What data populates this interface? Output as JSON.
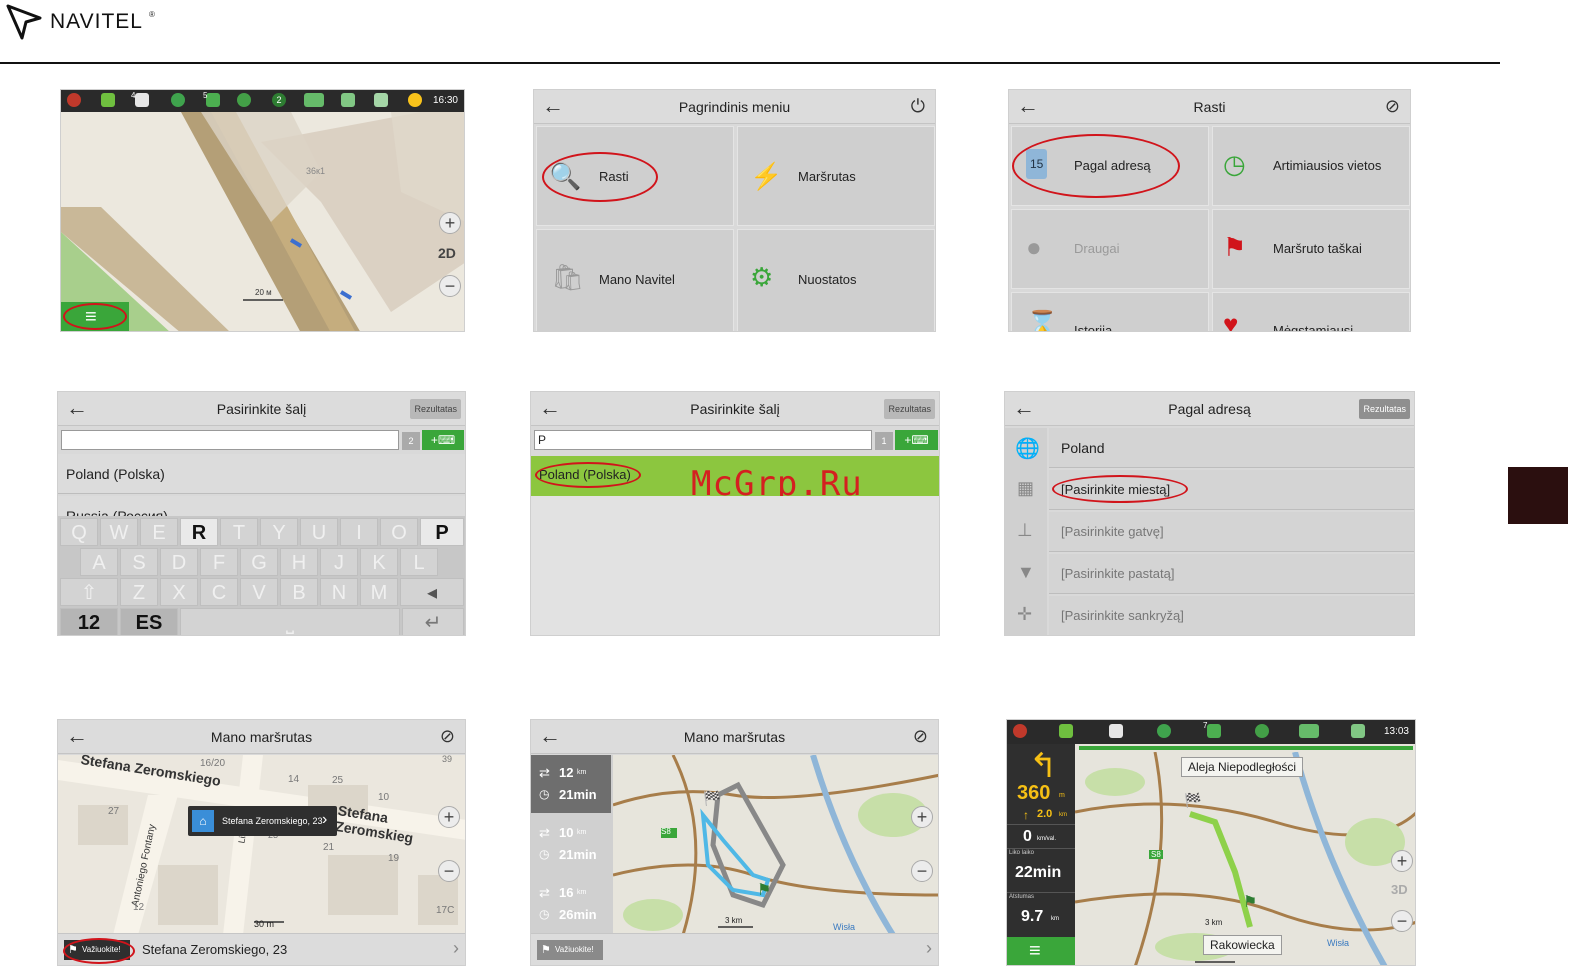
{
  "brand": {
    "name": "NAVITEL",
    "reg": "®"
  },
  "screen1": {
    "time": "16:30",
    "building_label": "36к1",
    "scale": "20 м",
    "btn_2d": "2D",
    "badge_a": "4",
    "badge_b": "5",
    "badge_c": "2"
  },
  "screen2": {
    "title": "Pagrindinis meniu",
    "tiles": [
      "Rasti",
      "Maršrutas",
      "Mano Navitel",
      "Nuostatos"
    ]
  },
  "screen3": {
    "title": "Rasti",
    "tiles": [
      "Pagal adresą",
      "Artimiausios vietos",
      "Draugai",
      "Maršruto taškai",
      "Istorija",
      "Mėgstamiausi"
    ],
    "badge": "15"
  },
  "screen4": {
    "title": "Pasirinkite šalį",
    "results_btn": "Rezultatas",
    "count": "2",
    "list": [
      "Poland (Polska)",
      "Russia (Россия)"
    ],
    "kbd_row1": [
      "Q",
      "W",
      "E",
      "R",
      "T",
      "Y",
      "U",
      "I",
      "O",
      "P"
    ],
    "kbd_row2": [
      "A",
      "S",
      "D",
      "F",
      "G",
      "H",
      "J",
      "K",
      "L"
    ],
    "kbd_row3": [
      "⇧",
      "Z",
      "X",
      "C",
      "V",
      "B",
      "N",
      "M",
      "◂"
    ],
    "mode_num": "12",
    "mode_lang": "ES"
  },
  "screen5": {
    "title": "Pasirinkite šalį",
    "results_btn": "Rezultatas",
    "input_value": "P",
    "count": "1",
    "result": "Poland (Polska)",
    "watermark": "McGrp.Ru"
  },
  "screen6": {
    "title": "Pagal adresą",
    "results_btn": "Rezultatas",
    "rows": [
      "Poland",
      "[Pasirinkite miestą]",
      "[Pasirinkite gatvę]",
      "[Pasirinkite pastatą]",
      "[Pasirinkite sankryžą]"
    ]
  },
  "screen7": {
    "title": "Mano maršrutas",
    "street1": "Stefana Zeromskiego",
    "street2": "Stefana Zeromskieg",
    "street3": "Lisowska",
    "street4": "Antoniego Fontany",
    "numbers": [
      "16/20",
      "14",
      "25",
      "27",
      "10",
      "21",
      "19",
      "12",
      "17C",
      "39",
      "23"
    ],
    "popup": "Stefana Zeromskiego, 23",
    "scale": "30 m",
    "go_btn": "Važiuokite!",
    "address": "Stefana Zeromskiego, 23"
  },
  "screen8": {
    "title": "Mano maršrutas",
    "routes": [
      {
        "dist": "12",
        "unit": "km",
        "time": "21min"
      },
      {
        "dist": "10",
        "unit": "km",
        "time": "21min"
      },
      {
        "dist": "16",
        "unit": "km",
        "time": "26min"
      }
    ],
    "scale": "3 km",
    "river": "Wisła",
    "road": "S8",
    "go_btn": "Važiuokite!"
  },
  "screen9": {
    "time": "13:03",
    "street_top": "Aleja Niepodległości",
    "street_bottom": "Rakowiecka",
    "turn_dist": "360",
    "turn_unit": "m",
    "next_dist": "2.0",
    "next_unit": "km",
    "speed": "0",
    "speed_unit": "km/val.",
    "time_left_label": "Liko laiko",
    "time_left": "22min",
    "distance_label": "Atstumas",
    "distance": "9.7",
    "distance_unit": "km",
    "scale": "3 km",
    "river": "Wisła",
    "road": "S8",
    "btn_3d": "3D",
    "badge": "7"
  }
}
